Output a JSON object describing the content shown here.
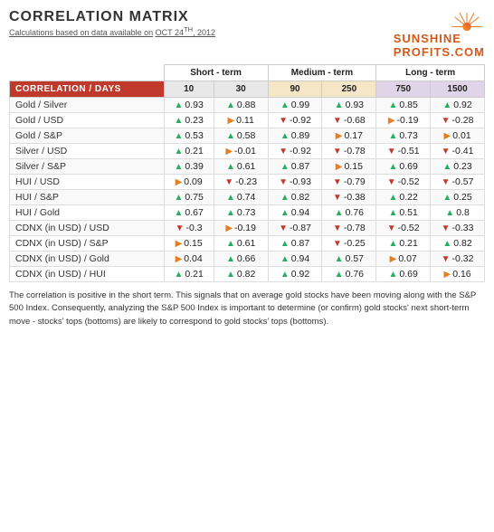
{
  "header": {
    "title": "CORRELATION MATRIX",
    "subtitle_prefix": "Calculations based on data available on",
    "subtitle_date": "OCT 24",
    "subtitle_sup": "TH",
    "subtitle_year": ", 2012",
    "logo_top": "SUNSHINE",
    "logo_bottom": "PROFITS.COM"
  },
  "group_headers": [
    {
      "label": "",
      "colspan": 1,
      "class": "empty"
    },
    {
      "label": "Short - term",
      "colspan": 2,
      "class": "group-short"
    },
    {
      "label": "Medium - term",
      "colspan": 2,
      "class": "group-medium"
    },
    {
      "label": "Long - term",
      "colspan": 2,
      "class": "group-long"
    }
  ],
  "col_headers": [
    "CORRELATION / DAYS",
    "10",
    "30",
    "90",
    "250",
    "750",
    "1500"
  ],
  "rows": [
    {
      "label": "Gold / Silver",
      "cells": [
        {
          "arrow": "up",
          "val": "0.93"
        },
        {
          "arrow": "up",
          "val": "0.88"
        },
        {
          "arrow": "up",
          "val": "0.99"
        },
        {
          "arrow": "up",
          "val": "0.93"
        },
        {
          "arrow": "up",
          "val": "0.85"
        },
        {
          "arrow": "up",
          "val": "0.92"
        }
      ]
    },
    {
      "label": "Gold / USD",
      "cells": [
        {
          "arrow": "up",
          "val": "0.23"
        },
        {
          "arrow": "right",
          "val": "0.11"
        },
        {
          "arrow": "down",
          "val": "-0.92"
        },
        {
          "arrow": "down",
          "val": "-0.68"
        },
        {
          "arrow": "right",
          "val": "-0.19"
        },
        {
          "arrow": "down",
          "val": "-0.28"
        }
      ]
    },
    {
      "label": "Gold / S&P",
      "cells": [
        {
          "arrow": "up",
          "val": "0.53"
        },
        {
          "arrow": "up",
          "val": "0.58"
        },
        {
          "arrow": "up",
          "val": "0.89"
        },
        {
          "arrow": "right",
          "val": "0.17"
        },
        {
          "arrow": "up",
          "val": "0.73"
        },
        {
          "arrow": "right",
          "val": "0.01"
        }
      ]
    },
    {
      "label": "Silver / USD",
      "cells": [
        {
          "arrow": "up",
          "val": "0.21"
        },
        {
          "arrow": "right",
          "val": "-0.01"
        },
        {
          "arrow": "down",
          "val": "-0.92"
        },
        {
          "arrow": "down",
          "val": "-0.78"
        },
        {
          "arrow": "down",
          "val": "-0.51"
        },
        {
          "arrow": "down",
          "val": "-0.41"
        }
      ]
    },
    {
      "label": "Silver / S&P",
      "cells": [
        {
          "arrow": "up",
          "val": "0.39"
        },
        {
          "arrow": "up",
          "val": "0.61"
        },
        {
          "arrow": "up",
          "val": "0.87"
        },
        {
          "arrow": "right",
          "val": "0.15"
        },
        {
          "arrow": "up",
          "val": "0.69"
        },
        {
          "arrow": "up",
          "val": "0.23"
        }
      ]
    },
    {
      "label": "HUI / USD",
      "cells": [
        {
          "arrow": "right",
          "val": "0.09"
        },
        {
          "arrow": "down",
          "val": "-0.23"
        },
        {
          "arrow": "down",
          "val": "-0.93"
        },
        {
          "arrow": "down",
          "val": "-0.79"
        },
        {
          "arrow": "down",
          "val": "-0.52"
        },
        {
          "arrow": "down",
          "val": "-0.57"
        }
      ]
    },
    {
      "label": "HUI / S&P",
      "cells": [
        {
          "arrow": "up",
          "val": "0.75"
        },
        {
          "arrow": "up",
          "val": "0.74"
        },
        {
          "arrow": "up",
          "val": "0.82"
        },
        {
          "arrow": "down",
          "val": "-0.38"
        },
        {
          "arrow": "up",
          "val": "0.22"
        },
        {
          "arrow": "up",
          "val": "0.25"
        }
      ]
    },
    {
      "label": "HUI / Gold",
      "cells": [
        {
          "arrow": "up",
          "val": "0.67"
        },
        {
          "arrow": "up",
          "val": "0.73"
        },
        {
          "arrow": "up",
          "val": "0.94"
        },
        {
          "arrow": "up",
          "val": "0.76"
        },
        {
          "arrow": "up",
          "val": "0.51"
        },
        {
          "arrow": "up",
          "val": "0.8"
        }
      ]
    },
    {
      "label": "CDNX (in USD) / USD",
      "cells": [
        {
          "arrow": "down",
          "val": "-0.3"
        },
        {
          "arrow": "right",
          "val": "-0.19"
        },
        {
          "arrow": "down",
          "val": "-0.87"
        },
        {
          "arrow": "down",
          "val": "-0.78"
        },
        {
          "arrow": "down",
          "val": "-0.52"
        },
        {
          "arrow": "down",
          "val": "-0.33"
        }
      ]
    },
    {
      "label": "CDNX (in USD) / S&P",
      "cells": [
        {
          "arrow": "right",
          "val": "0.15"
        },
        {
          "arrow": "up",
          "val": "0.61"
        },
        {
          "arrow": "up",
          "val": "0.87"
        },
        {
          "arrow": "down",
          "val": "-0.25"
        },
        {
          "arrow": "up",
          "val": "0.21"
        },
        {
          "arrow": "up",
          "val": "0.82"
        }
      ]
    },
    {
      "label": "CDNX (in USD) / Gold",
      "cells": [
        {
          "arrow": "right",
          "val": "0.04"
        },
        {
          "arrow": "up",
          "val": "0.66"
        },
        {
          "arrow": "up",
          "val": "0.94"
        },
        {
          "arrow": "up",
          "val": "0.57"
        },
        {
          "arrow": "right",
          "val": "0.07"
        },
        {
          "arrow": "down",
          "val": "-0.32"
        }
      ]
    },
    {
      "label": "CDNX (in USD) / HUI",
      "cells": [
        {
          "arrow": "up",
          "val": "0.21"
        },
        {
          "arrow": "up",
          "val": "0.82"
        },
        {
          "arrow": "up",
          "val": "0.92"
        },
        {
          "arrow": "up",
          "val": "0.76"
        },
        {
          "arrow": "up",
          "val": "0.69"
        },
        {
          "arrow": "right",
          "val": "0.16"
        }
      ]
    }
  ],
  "footer": "The correlation is positive in the short term. This signals that on average gold stocks have been moving along with the S&P 500 Index. Consequently, analyzing the S&P 500 Index is important to determine (or confirm) gold stocks' next short-term move - stocks' tops (bottoms) are likely to correspond to gold stocks' tops (bottoms)."
}
